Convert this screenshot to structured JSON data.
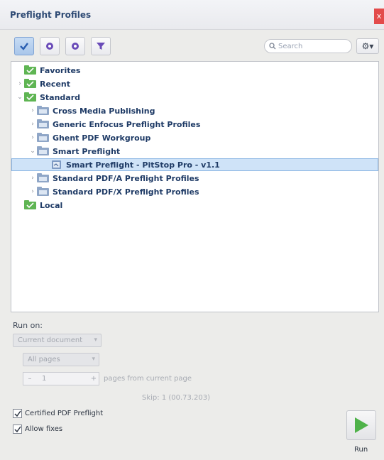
{
  "window": {
    "title": "Preflight Profiles",
    "close_glyph": "x"
  },
  "toolbar": {
    "buttons": [
      {
        "icon": "checkmark-icon",
        "active": true
      },
      {
        "icon": "circle-icon"
      },
      {
        "icon": "gear-icon"
      },
      {
        "icon": "filter-icon"
      }
    ],
    "search_placeholder": "Search",
    "options_glyph": "⚙▾"
  },
  "tree": {
    "items": [
      {
        "label": "Favorites",
        "expander": "",
        "icon": "green-folder-icon"
      },
      {
        "label": "Recent",
        "expander": ">",
        "icon": "green-folder-icon"
      },
      {
        "label": "Standard",
        "expander": "v",
        "icon": "green-folder-icon"
      },
      {
        "label": "Cross Media Publishing",
        "expander": ">",
        "icon": "profile-folder-icon"
      },
      {
        "label": "Generic Enfocus Preflight Profiles",
        "expander": ">",
        "icon": "profile-folder-icon"
      },
      {
        "label": "Ghent PDF Workgroup",
        "expander": ">",
        "icon": "profile-folder-icon"
      },
      {
        "label": "Smart Preflight",
        "expander": "v",
        "icon": "profile-folder-icon"
      },
      {
        "label": "Smart Preflight - PitStop Pro - v1.1",
        "expander": "",
        "icon": "profile-icon",
        "selected": true
      },
      {
        "label": "Standard PDF/A Preflight Profiles",
        "expander": ">",
        "icon": "profile-folder-icon"
      },
      {
        "label": "Standard PDF/X Preflight Profiles",
        "expander": ">",
        "icon": "profile-folder-icon"
      },
      {
        "label": "Local",
        "expander": "",
        "icon": "green-folder-icon"
      }
    ]
  },
  "run_on": {
    "label": "Run on:",
    "document_select": "Current document",
    "pages_select": "All pages",
    "page_count": "1",
    "pages_suffix": "pages from current page",
    "version_text": "Skip: 1 (00.73.203)"
  },
  "options": {
    "certified_label": "Certified PDF Preflight",
    "allow_fixes_label": "Allow fixes"
  },
  "run_button": {
    "label": "Run"
  },
  "colors": {
    "accent_green": "#4fb24a",
    "selection": "#cfe3f8",
    "close_red": "#e34b4b"
  }
}
